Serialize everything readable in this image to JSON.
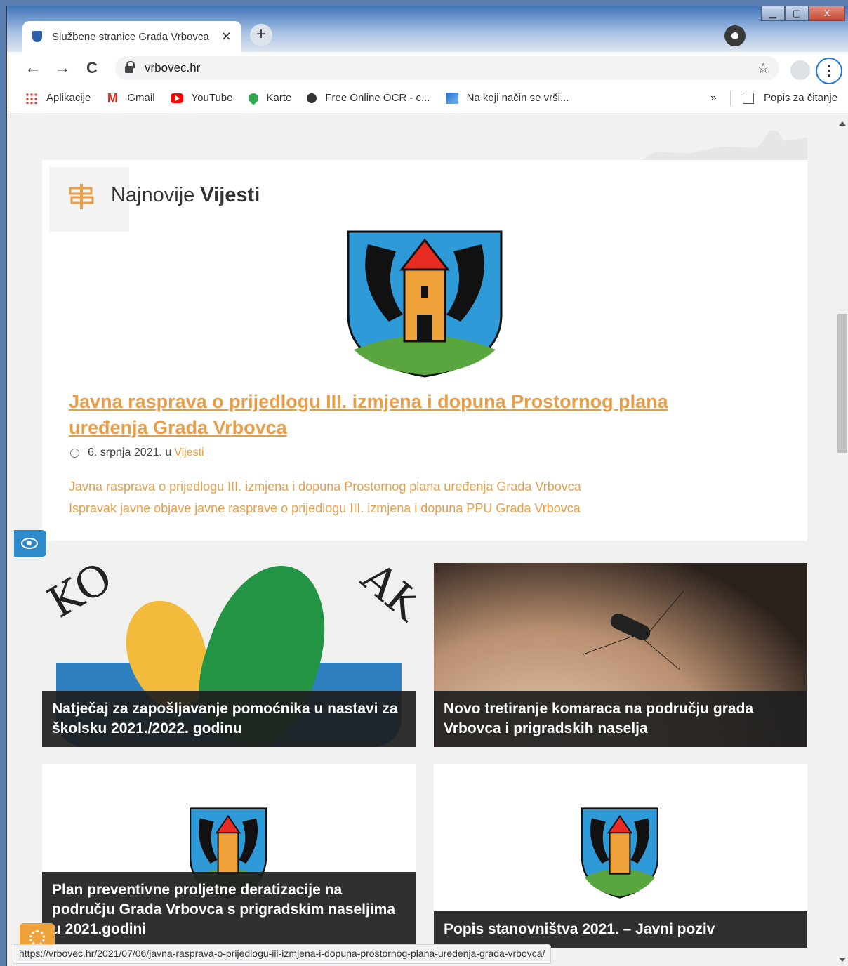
{
  "browser": {
    "tab_title": "Službene stranice Grada Vrbovca",
    "tab_close": "✕",
    "new_tab": "+",
    "url": "vrbovec.hr",
    "back": "←",
    "forward": "→",
    "reload": "C",
    "bookmark_star": "☆",
    "menu": "⋮",
    "window_buttons": {
      "minimize": "▁",
      "maximize": "▢",
      "close": "X"
    },
    "bookmarks": [
      {
        "label": "Aplikacije",
        "icon": "apps-grid-icon"
      },
      {
        "label": "Gmail",
        "icon": "gmail-icon"
      },
      {
        "label": "YouTube",
        "icon": "youtube-icon"
      },
      {
        "label": "Karte",
        "icon": "maps-pin-icon"
      },
      {
        "label": "Free Online OCR - c...",
        "icon": "ocr-icon"
      },
      {
        "label": "Na koji način se vrši...",
        "icon": "site-icon"
      }
    ],
    "bookmarks_more": "»",
    "reading_list": "Popis za čitanje",
    "status_url": "https://vrbovec.hr/2021/07/06/javna-rasprava-o-prijedlogu-iii-izmjena-i-dopuna-prostornog-plana-uredenja-grada-vrbovca/"
  },
  "page": {
    "section": {
      "title_light": "Najnovije",
      "title_bold": "Vijesti"
    },
    "featured": {
      "title": "Javna rasprava o prijedlogu III. izmjena i dopuna Prostornog plana uređenja Grada Vrbovca",
      "date": "6. srpnja 2021.",
      "in_word": "u",
      "category": "Vijesti",
      "links": [
        "Javna rasprava o prijedlogu III. izmjena i dopuna Prostornog plana uređenja Grada Vrbovca",
        "Ispravak javne objave javne rasprave o prijedlogu III. izmjena i dopuna PPU Grada Vrbovca"
      ]
    },
    "cards": [
      {
        "title": "Natječaj za zapošljavanje pomoćnika u nastavi za školsku 2021./2022. godinu"
      },
      {
        "title": "Novo tretiranje komaraca na području grada Vrbovca i prigradskih naselja"
      },
      {
        "title": "Plan preventivne proljetne deratizacije na području Grada Vrbovca s prigradskim naseljima u 2021.godini"
      },
      {
        "title": "Popis stanovništva 2021. – Javni poziv"
      }
    ]
  },
  "colors": {
    "accent": "#e79e4a",
    "accessibility": "#2e8bc9",
    "settings": "#f0a23a"
  }
}
